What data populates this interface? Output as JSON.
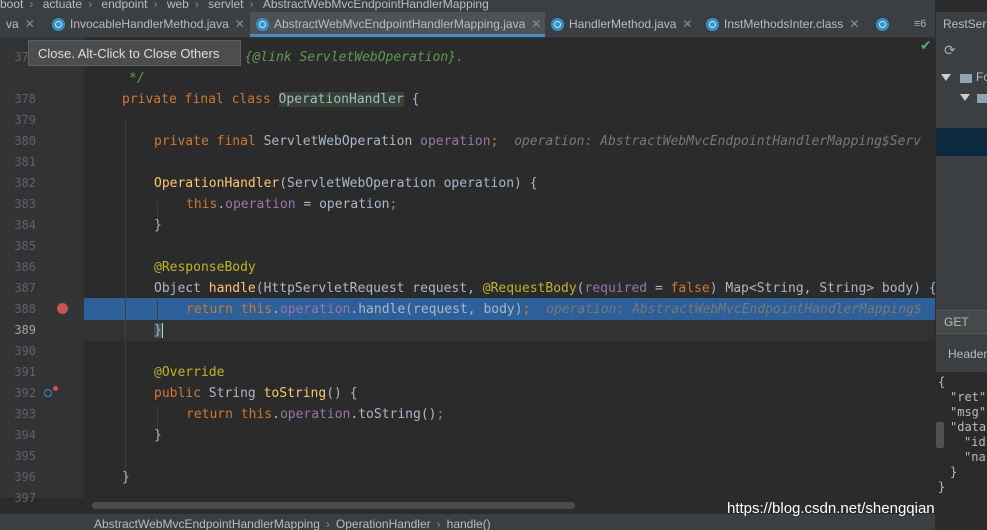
{
  "top_breadcrumb": [
    "boot",
    "actuate",
    "endpoint",
    "web",
    "servlet",
    "AbstractWebMvcEndpointHandlerMapping"
  ],
  "tabs": [
    {
      "label": "va",
      "active": false
    },
    {
      "label": "InvocableHandlerMethod.java",
      "active": false
    },
    {
      "label": "AbstractWebMvcEndpointHandlerMapping.java",
      "active": true
    },
    {
      "label": "HandlerMethod.java",
      "active": false
    },
    {
      "label": "InstMethodsInter.class",
      "active": false
    }
  ],
  "tab_overflow": "≡6",
  "tooltip": "Close. Alt-Click to Close Others",
  "editor": {
    "line_numbers": [
      "377",
      "378",
      "379",
      "380",
      "381",
      "382",
      "383",
      "384",
      "385",
      "386",
      "387",
      "388",
      "389",
      "390",
      "391",
      "392",
      "393",
      "394",
      "395",
      "396",
      "397"
    ],
    "current_line": "389",
    "highlighted_line": "388",
    "doc_line_a": "a {@link ServletWebOperation}.",
    "doc_line_b": "*/",
    "class_decl_kw": "private final class ",
    "class_name": "OperationHandler",
    "class_brace": " {",
    "field_kw": "private final ",
    "field_type": "ServletWebOperation ",
    "field_name": "operation",
    "field_semi": ";",
    "field_hint": "operation: AbstractWebMvcEndpointHandlerMapping$Serv",
    "ctor_name": "OperationHandler",
    "ctor_params": "(ServletWebOperation operation) {",
    "ctor_this": "this",
    "ctor_dot": ".",
    "ctor_field": "operation",
    "ctor_assign": " = operation",
    "ctor_semi": ";",
    "close_brace": "}",
    "ann_response_body": "@ResponseBody",
    "handle_ret": "Object ",
    "handle_name": "handle",
    "handle_p1": "(HttpServletRequest request, ",
    "handle_ann": "@RequestBody",
    "handle_p2": "(",
    "handle_required": "required",
    "handle_eq": " = ",
    "handle_false": "false",
    "handle_p3": ") Map<String, String> body) {",
    "ret_kw": "return ",
    "ret_this": "this",
    "ret_dot": ".",
    "ret_field": "operation",
    "ret_call": ".handle(request, body)",
    "ret_semi": ";",
    "ret_hint": "operation: AbstractWebMvcEndpointHandlerMapping$",
    "caret_brace": "}",
    "ann_override": "@Override",
    "tostr_kw": "public ",
    "tostr_type": "String ",
    "tostr_name": "toString",
    "tostr_paren": "() {",
    "tostr_ret_kw": "return ",
    "tostr_this": "this",
    "tostr_dot": ".",
    "tostr_field": "operation",
    "tostr_call": ".toString()",
    "tostr_semi": ";",
    "class_close": "}"
  },
  "bottom_breadcrumb": [
    "AbstractWebMvcEndpointHandlerMapping",
    "OperationHandler",
    "handle()"
  ],
  "watermark": "https://blog.csdn.net/shengqianfeng",
  "right_panel": {
    "title": "RestSer",
    "tree_label": "Fo",
    "method": "GET",
    "headers_label": "Header",
    "json_lines": [
      "{",
      "\"ret\"",
      "\"msg\"",
      "\"data",
      "\"id",
      "\"na",
      "}",
      "}"
    ]
  }
}
